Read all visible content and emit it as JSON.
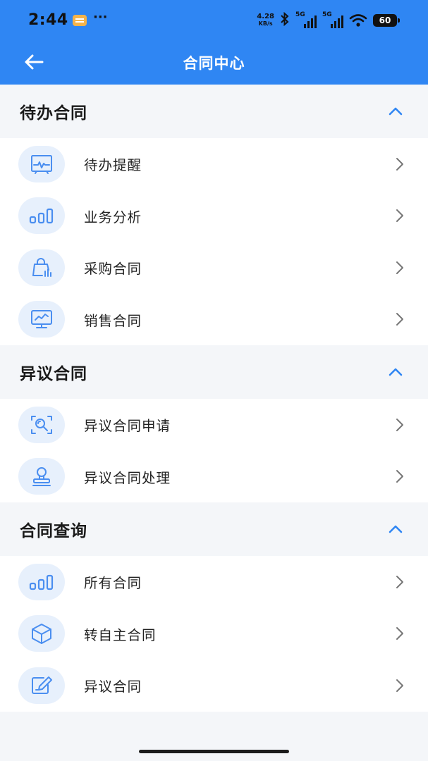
{
  "status_bar": {
    "time": "2:44",
    "dots": "···",
    "net_speed_value": "4.28",
    "net_speed_unit": "KB/s",
    "sim1_label": "5G",
    "sim2_label": "5G",
    "battery": "60",
    "icons": [
      "message-notification-icon",
      "bluetooth-icon",
      "signal-icon",
      "signal-icon",
      "wifi-icon",
      "battery-icon"
    ]
  },
  "nav": {
    "title": "合同中心",
    "back_icon": "arrow-left-icon"
  },
  "colors": {
    "primary": "#2f86f3",
    "icon_blue": "#4a8ef0",
    "icon_bg": "#e7f0fc",
    "page_bg": "#f4f6f9"
  },
  "sections": [
    {
      "title": "待办合同",
      "collapse_icon": "chevron-up-icon",
      "items": [
        {
          "label": "待办提醒",
          "icon": "activity-board-icon"
        },
        {
          "label": "业务分析",
          "icon": "bar-chart-icon"
        },
        {
          "label": "采购合同",
          "icon": "shopping-bag-icon"
        },
        {
          "label": "销售合同",
          "icon": "monitor-chart-icon"
        }
      ]
    },
    {
      "title": "异议合同",
      "collapse_icon": "chevron-up-icon",
      "items": [
        {
          "label": "异议合同申请",
          "icon": "document-search-icon"
        },
        {
          "label": "异议合同处理",
          "icon": "stamp-icon"
        }
      ]
    },
    {
      "title": "合同查询",
      "collapse_icon": "chevron-up-icon",
      "items": [
        {
          "label": "所有合同",
          "icon": "bar-chart-icon"
        },
        {
          "label": "转自主合同",
          "icon": "cube-icon"
        },
        {
          "label": "异议合同",
          "icon": "edit-icon"
        }
      ]
    }
  ]
}
